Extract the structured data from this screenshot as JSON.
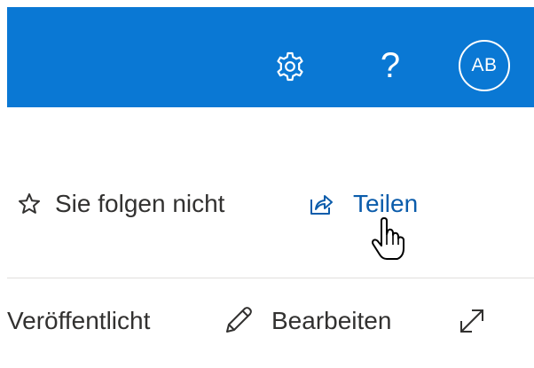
{
  "header": {
    "settings_icon": "gear-icon",
    "help_label": "?",
    "avatar_initials": "AB",
    "background_color": "#0a78d4"
  },
  "page_actions": {
    "follow_label": "Sie folgen nicht",
    "follow_icon": "star-outline-icon",
    "share_label": "Teilen",
    "share_icon": "share-icon",
    "share_color": "#0b5cab"
  },
  "status_bar": {
    "status_label": "Veröffentlicht",
    "edit_label": "Bearbeiten",
    "edit_icon": "pencil-icon",
    "expand_icon": "expand-icon"
  },
  "cursor": {
    "type": "hand-pointer-icon"
  }
}
